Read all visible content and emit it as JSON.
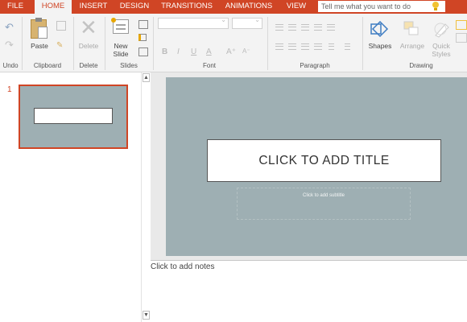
{
  "tabs": [
    {
      "label": "FILE",
      "active": false
    },
    {
      "label": "HOME",
      "active": true
    },
    {
      "label": "INSERT",
      "active": false
    },
    {
      "label": "DESIGN",
      "active": false
    },
    {
      "label": "TRANSITIONS",
      "active": false
    },
    {
      "label": "ANIMATIONS",
      "active": false
    },
    {
      "label": "VIEW",
      "active": false
    }
  ],
  "tell_me": {
    "placeholder": "Tell me what you want to do"
  },
  "ribbon": {
    "groups": {
      "undo": "Undo",
      "clipboard": "Clipboard",
      "delete": "Delete",
      "slides": "Slides",
      "font": "Font",
      "paragraph": "Paragraph",
      "drawing": "Drawing"
    },
    "buttons": {
      "paste": "Paste",
      "delete": "Delete",
      "new_slide": "New Slide",
      "shapes": "Shapes",
      "arrange": "Arrange",
      "quick_styles": "Quick Styles"
    },
    "font_buttons": [
      "B",
      "I",
      "U",
      "A",
      "A⁺",
      "A⁻"
    ]
  },
  "slides": [
    {
      "number": "1",
      "title": "CLICK TO ADD TITLE",
      "subtitle": "Click to add subtitle",
      "background": "#9eafb3"
    }
  ],
  "notes_placeholder": "Click to add notes",
  "colors": {
    "accent": "#d04525",
    "slide_bg": "#9eafb3"
  }
}
